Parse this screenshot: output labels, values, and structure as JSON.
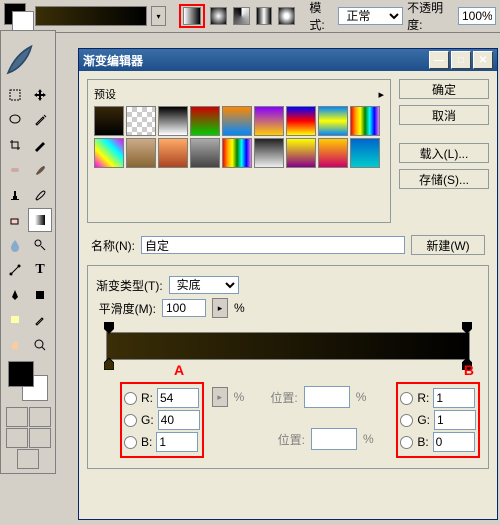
{
  "topbar": {
    "mode_label": "模式:",
    "mode_value": "正常",
    "opacity_label": "不透明度:",
    "opacity_value": "100%"
  },
  "dialog": {
    "title": "渐变编辑器",
    "presets_label": "预设",
    "buttons": {
      "ok": "确定",
      "cancel": "取消",
      "load": "载入(L)...",
      "save": "存储(S)...",
      "new": "新建(W)"
    },
    "name_label": "名称(N):",
    "name_value": "自定",
    "type_label": "渐变类型(T):",
    "type_value": "实底",
    "smooth_label": "平滑度(M):",
    "smooth_value": "100",
    "percent": "%",
    "pos_label": "位置:"
  },
  "markers": {
    "a": "A",
    "b": "B"
  },
  "rgbA": {
    "R_label": "R:",
    "G_label": "G:",
    "B_label": "B:",
    "R": "54",
    "G": "40",
    "B": "1"
  },
  "rgbB": {
    "R_label": "R:",
    "G_label": "G:",
    "B_label": "B:",
    "R": "1",
    "G": "1",
    "B": "0"
  }
}
